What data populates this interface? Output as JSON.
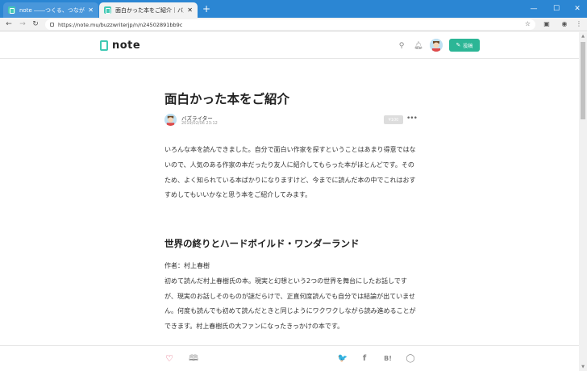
{
  "browser": {
    "tabs": [
      {
        "title": "note ――つくる、つながる、とどける。",
        "active": false
      },
      {
        "title": "面白かった本をご紹介｜バズライター",
        "active": true
      }
    ],
    "new_tab_icon": "+",
    "url": "https://note.mu/buzzwriterjp/n/n24502891bb9c",
    "window_controls": {
      "minimize": "—",
      "maximize": "☐",
      "close": "✕"
    }
  },
  "site": {
    "logo_text": "note",
    "post_button_label": "投稿",
    "accent_color": "#2cb696"
  },
  "article": {
    "title": "面白かった本をご紹介",
    "author": "バズライター",
    "date": "2019/02/06 23:12",
    "price_label": "¥100",
    "intro": "いろんな本を読んできました。自分で面白い作家を探すということはあまり得意ではないので、人気のある作家の本だったり友人に紹介してもらった本がほとんどです。そのため、よく知られている本ばかりになりますけど、今までに読んだ本の中でこれはおすすめしてもいいかなと思う本をご紹介してみます。",
    "section_heading": "世界の終りとハードボイルド・ワンダーランド",
    "body_lines": [
      "作者：村上春樹",
      "初めて読んだ村上春樹氏の本。現実と幻想という2つの世界を舞台にしたお話しですが、現実のお話しそのものが謎だらけで、正直何度読んでも自分では結論が出ていません。何度も読んでも初めて読んだときと同じようにワクワクしながら読み進めることができます。村上春樹氏の大ファンになったきっかけの本です。"
    ]
  },
  "icons": {
    "like": "♡",
    "magazine": "🕮",
    "twitter": "🐦",
    "facebook": "f",
    "hatena": "B!",
    "line": "◯"
  }
}
